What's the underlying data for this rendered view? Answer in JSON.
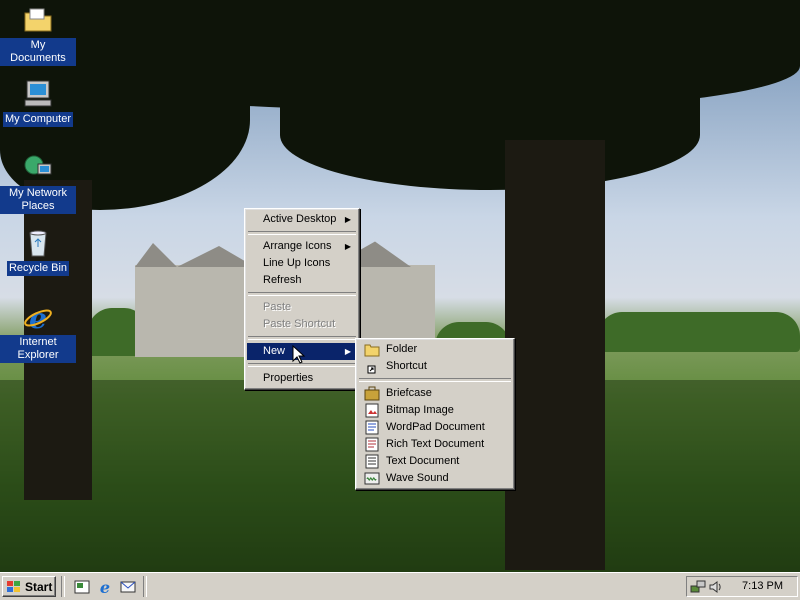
{
  "desktop": {
    "icons": [
      {
        "label": "My Documents",
        "icon": "folder-documents-icon"
      },
      {
        "label": "My Computer",
        "icon": "computer-icon"
      },
      {
        "label": "My Network Places",
        "icon": "network-places-icon"
      },
      {
        "label": "Recycle Bin",
        "icon": "recycle-bin-icon"
      },
      {
        "label": "Internet Explorer",
        "icon": "internet-explorer-icon"
      }
    ]
  },
  "context_menu": {
    "items": {
      "active_desktop": "Active Desktop",
      "arrange_icons": "Arrange Icons",
      "line_up_icons": "Line Up Icons",
      "refresh": "Refresh",
      "paste": "Paste",
      "paste_shortcut": "Paste Shortcut",
      "new": "New",
      "properties": "Properties"
    }
  },
  "new_submenu": {
    "items": {
      "folder": "Folder",
      "shortcut": "Shortcut",
      "briefcase": "Briefcase",
      "bitmap_image": "Bitmap Image",
      "wordpad_document": "WordPad Document",
      "rich_text_document": "Rich Text Document",
      "text_document": "Text Document",
      "wave_sound": "Wave Sound"
    }
  },
  "taskbar": {
    "start_label": "Start",
    "clock": "7:13 PM"
  },
  "colors": {
    "menu_face": "#d4d0c8",
    "selection": "#0a246a",
    "icon_label_bg": "#123a8c"
  }
}
